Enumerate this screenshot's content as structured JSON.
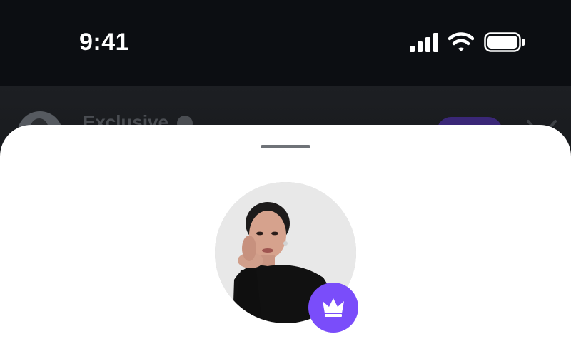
{
  "status_bar": {
    "time": "9:41",
    "icons": [
      "signal-icon",
      "wifi-icon",
      "battery-icon"
    ]
  },
  "background_card": {
    "name": "Exclusive",
    "icons": [
      "avatar",
      "verified-icon",
      "close-icon"
    ],
    "colors": {
      "join_button": "#3a2777",
      "text": "#4a4d52"
    }
  },
  "sheet": {
    "icons": [
      "crown-icon"
    ],
    "colors": {
      "badge": "#7a4dfa",
      "sheet": "#ffffff"
    }
  }
}
